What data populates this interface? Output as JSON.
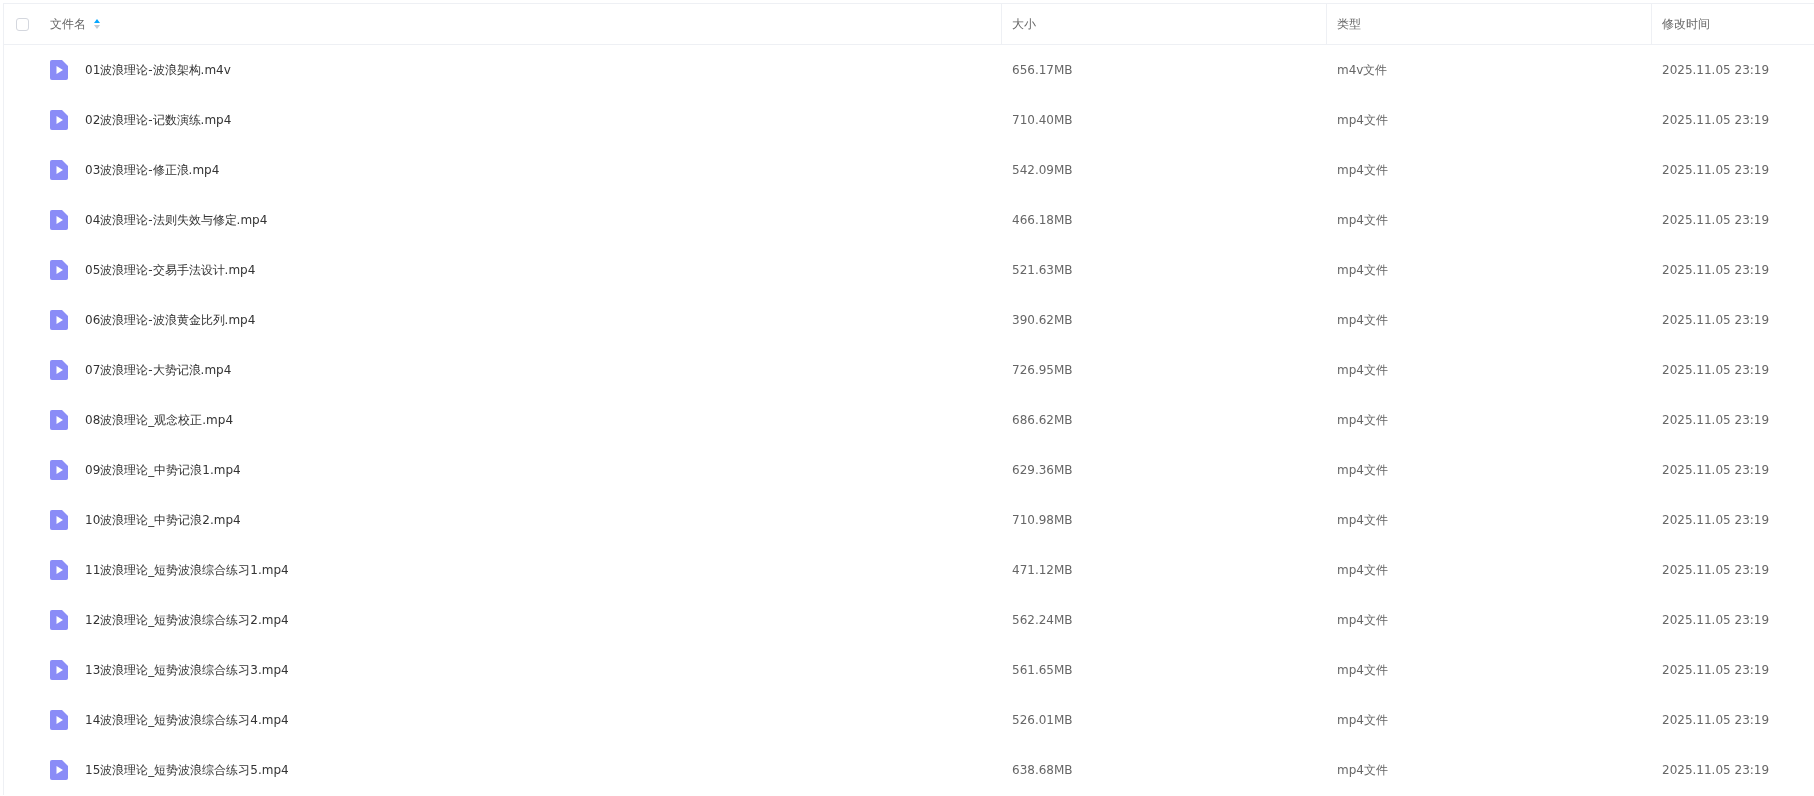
{
  "table": {
    "select_all": {
      "checked": false
    },
    "columns": [
      {
        "label": "文件名",
        "sorted": true
      },
      {
        "label": "大小",
        "sorted": false
      },
      {
        "label": "类型",
        "sorted": false
      },
      {
        "label": "修改时间",
        "sorted": false
      }
    ],
    "rows": [
      {
        "name": "01波浪理论-波浪架构.m4v",
        "size": "656.17MB",
        "type": "m4v文件",
        "modified": "2025.11.05 23:19"
      },
      {
        "name": "02波浪理论-记数演练.mp4",
        "size": "710.40MB",
        "type": "mp4文件",
        "modified": "2025.11.05 23:19"
      },
      {
        "name": "03波浪理论-修正浪.mp4",
        "size": "542.09MB",
        "type": "mp4文件",
        "modified": "2025.11.05 23:19"
      },
      {
        "name": "04波浪理论-法则失效与修定.mp4",
        "size": "466.18MB",
        "type": "mp4文件",
        "modified": "2025.11.05 23:19"
      },
      {
        "name": "05波浪理论-交易手法设计.mp4",
        "size": "521.63MB",
        "type": "mp4文件",
        "modified": "2025.11.05 23:19"
      },
      {
        "name": "06波浪理论-波浪黄金比列.mp4",
        "size": "390.62MB",
        "type": "mp4文件",
        "modified": "2025.11.05 23:19"
      },
      {
        "name": "07波浪理论-大势记浪.mp4",
        "size": "726.95MB",
        "type": "mp4文件",
        "modified": "2025.11.05 23:19"
      },
      {
        "name": "08波浪理论_观念校正.mp4",
        "size": "686.62MB",
        "type": "mp4文件",
        "modified": "2025.11.05 23:19"
      },
      {
        "name": "09波浪理论_中势记浪1.mp4",
        "size": "629.36MB",
        "type": "mp4文件",
        "modified": "2025.11.05 23:19"
      },
      {
        "name": "10波浪理论_中势记浪2.mp4",
        "size": "710.98MB",
        "type": "mp4文件",
        "modified": "2025.11.05 23:19"
      },
      {
        "name": "11波浪理论_短势波浪综合练习1.mp4",
        "size": "471.12MB",
        "type": "mp4文件",
        "modified": "2025.11.05 23:19"
      },
      {
        "name": "12波浪理论_短势波浪综合练习2.mp4",
        "size": "562.24MB",
        "type": "mp4文件",
        "modified": "2025.11.05 23:19"
      },
      {
        "name": "13波浪理论_短势波浪综合练习3.mp4",
        "size": "561.65MB",
        "type": "mp4文件",
        "modified": "2025.11.05 23:19"
      },
      {
        "name": "14波浪理论_短势波浪综合练习4.mp4",
        "size": "526.01MB",
        "type": "mp4文件",
        "modified": "2025.11.05 23:19"
      },
      {
        "name": "15波浪理论_短势波浪综合练习5.mp4",
        "size": "638.68MB",
        "type": "mp4文件",
        "modified": "2025.11.05 23:19"
      }
    ]
  }
}
